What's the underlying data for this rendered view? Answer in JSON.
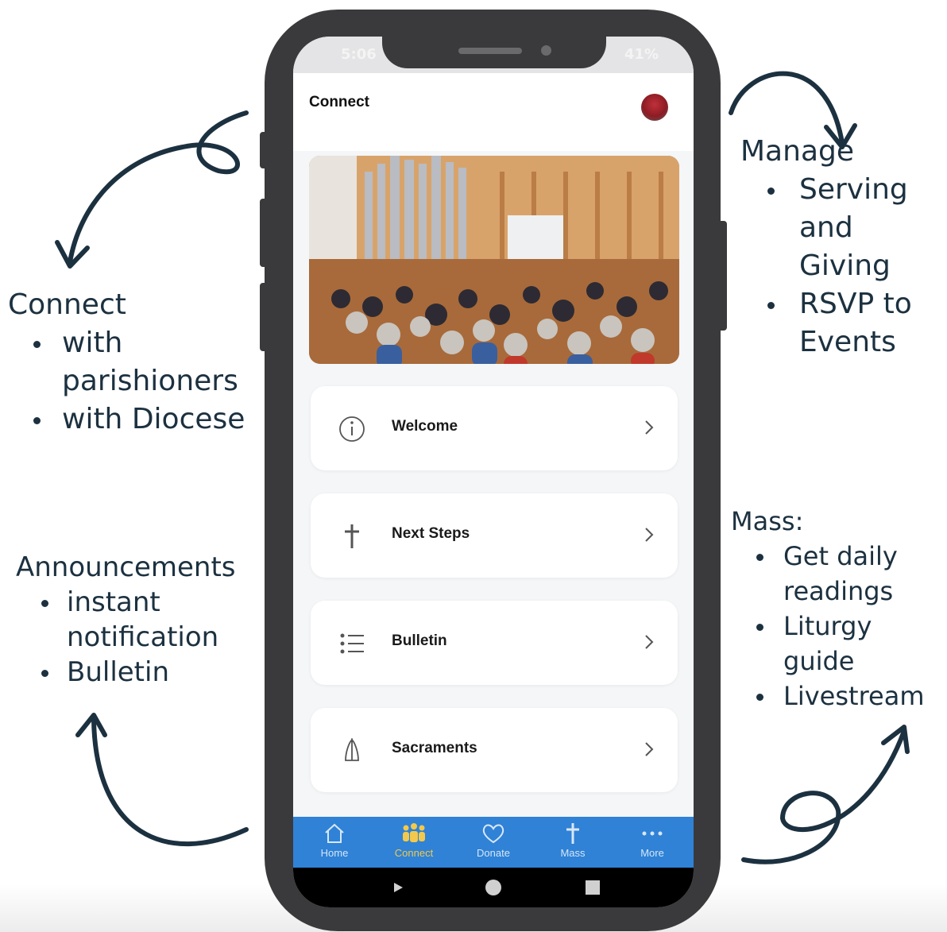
{
  "annotations": {
    "connect": {
      "heading": "Connect",
      "items": [
        "with parishioners",
        "with Diocese"
      ]
    },
    "manage": {
      "heading": "Manage",
      "items": [
        " Serving and Giving",
        "RSVP to Events"
      ]
    },
    "announcements": {
      "heading": "Announcements",
      "items": [
        "instant notification",
        "Bulletin"
      ]
    },
    "mass": {
      "heading": "Mass:",
      "items": [
        "Get daily readings",
        "Liturgy guide",
        " Livestream"
      ]
    }
  },
  "phone": {
    "status": {
      "time": "5:06",
      "battery": "41%"
    },
    "header": {
      "title": "Connect"
    },
    "menu": [
      {
        "label": "Welcome",
        "icon": "info-icon"
      },
      {
        "label": "Next Steps",
        "icon": "cross-icon"
      },
      {
        "label": "Bulletin",
        "icon": "list-icon"
      },
      {
        "label": "Sacraments",
        "icon": "praying-hands-icon"
      }
    ],
    "tabs": [
      {
        "label": "Home",
        "icon": "home-icon",
        "active": false
      },
      {
        "label": "Connect",
        "icon": "people-icon",
        "active": true
      },
      {
        "label": "Donate",
        "icon": "heart-icon",
        "active": false
      },
      {
        "label": "Mass",
        "icon": "cross-icon",
        "active": false
      },
      {
        "label": "More",
        "icon": "dots-icon",
        "active": false
      }
    ],
    "colors": {
      "tab_bar": "#2f82d6",
      "active_tab": "#f2c94c",
      "frame": "#3a3a3c"
    }
  }
}
